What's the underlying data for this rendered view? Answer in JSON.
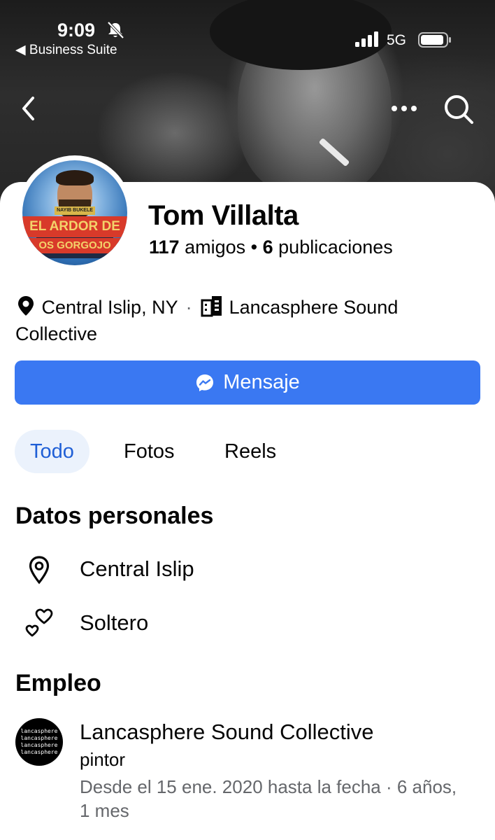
{
  "status_bar": {
    "time": "9:09",
    "back_app": "◀ Business Suite",
    "network": "5G"
  },
  "nav": {
    "back_icon": "chevron-left-icon",
    "more_icon": "more-horizontal-icon",
    "search_icon": "search-icon"
  },
  "avatar_art": {
    "tag": "NAYIB BUKELE",
    "title": "EL ARDOR DE",
    "subtitle": "OS GORGOJO"
  },
  "profile": {
    "name": "Tom Villalta",
    "friends_count": "117",
    "friends_label": "amigos",
    "separator": "•",
    "posts_count": "6",
    "posts_label": "publicaciones"
  },
  "intro": {
    "location": "Central Islip, NY",
    "separator": "·",
    "workplace": "Lancasphere Sound Collective"
  },
  "message_button": {
    "label": "Mensaje"
  },
  "tabs": [
    {
      "label": "Todo",
      "active": true
    },
    {
      "label": "Fotos",
      "active": false
    },
    {
      "label": "Reels",
      "active": false
    }
  ],
  "personal_details": {
    "title": "Datos personales",
    "items": [
      {
        "icon": "location-pin-icon",
        "text": "Central Islip"
      },
      {
        "icon": "hearts-icon",
        "text": "Soltero"
      }
    ]
  },
  "employment": {
    "title": "Empleo",
    "logo_text": [
      "lancasphere",
      "lancasphere",
      "lancasphere",
      "lancasphere"
    ],
    "company": "Lancasphere Sound Collective",
    "role": "pintor",
    "dates": "Desde el 15 ene. 2020 hasta la fecha · 6 años, 1 mes"
  },
  "colors": {
    "accent": "#3a78f2",
    "active_tab_bg": "#ebf2fc",
    "active_tab_text": "#1f5fd6",
    "secondary_text": "#65676b"
  }
}
